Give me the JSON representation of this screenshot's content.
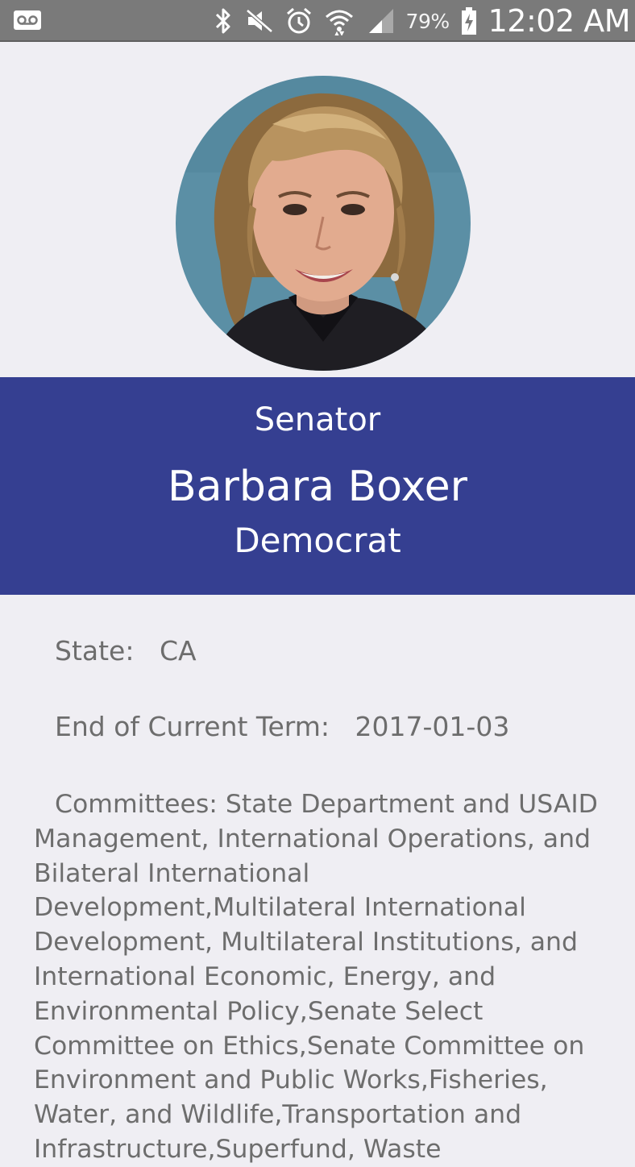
{
  "status_bar": {
    "left_icon": "voicemail-icon",
    "icons": [
      "bluetooth-icon",
      "mute-icon",
      "alarm-icon",
      "wifi-icon",
      "signal-icon"
    ],
    "battery_percent": "79%",
    "battery_icon": "battery-charging-icon",
    "time": "12:02 AM"
  },
  "profile": {
    "photo": "profile-photo",
    "role": "Senator",
    "name": "Barbara Boxer",
    "party": "Democrat"
  },
  "details": {
    "state_label": "State:",
    "state_value": "CA",
    "term_label": "End of Current Term:",
    "term_value": "2017-01-03",
    "committees_label": "Committees:",
    "committees_value": "State Department and USAID Management, International Operations, and Bilateral International Development,Multilateral International Development, Multilateral Institutions, and International Economic, Energy, and Environmental Policy,Senate Select Committee on Ethics,Senate Committee on Environment and Public Works,Fisheries, Water, and Wildlife,Transportation and Infrastructure,Superfund, Waste"
  },
  "colors": {
    "status_bar": "#7a7a7a",
    "banner": "#353f91",
    "background": "#efeef3",
    "detail_text": "#6d6d6d"
  }
}
